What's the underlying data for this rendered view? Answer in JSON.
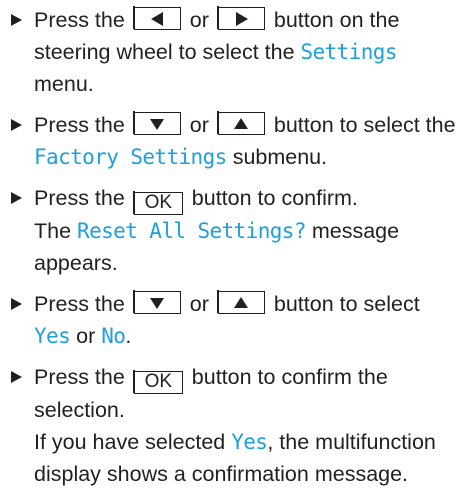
{
  "colors": {
    "text": "#231f20",
    "display_text": "#1ea0dc"
  },
  "keys": {
    "left_icon": "left-triangle-icon",
    "right_icon": "right-triangle-icon",
    "down_icon": "down-triangle-icon",
    "up_icon": "up-triangle-icon",
    "ok": "OK"
  },
  "steps": [
    {
      "line1_a": "Press the",
      "line1_or": "or",
      "line1_b": "button on the",
      "line2_a": "steering wheel to select the",
      "display_term": "Settings",
      "line3": "menu."
    },
    {
      "line1_a": "Press the",
      "line1_or": "or",
      "line1_b": "button to select the",
      "display_term": "Factory Settings",
      "line2_b": "submenu."
    },
    {
      "line1_a": "Press the",
      "line1_b": "button to confirm.",
      "line2_a": "The",
      "display_term": "Reset All Settings?",
      "line2_b": "message",
      "line3": "appears."
    },
    {
      "line1_a": "Press the",
      "line1_or": "or",
      "line1_b": "button to select",
      "display_yes": "Yes",
      "line2_or": "or",
      "display_no": "No",
      "line2_end": "."
    },
    {
      "line1_a": "Press the",
      "line1_b": "button to confirm the",
      "line2": "selection.",
      "line3_a": "If you have selected",
      "display_yes": "Yes",
      "line3_b": ", the multifunction",
      "line4": "display shows a confirmation message."
    }
  ]
}
